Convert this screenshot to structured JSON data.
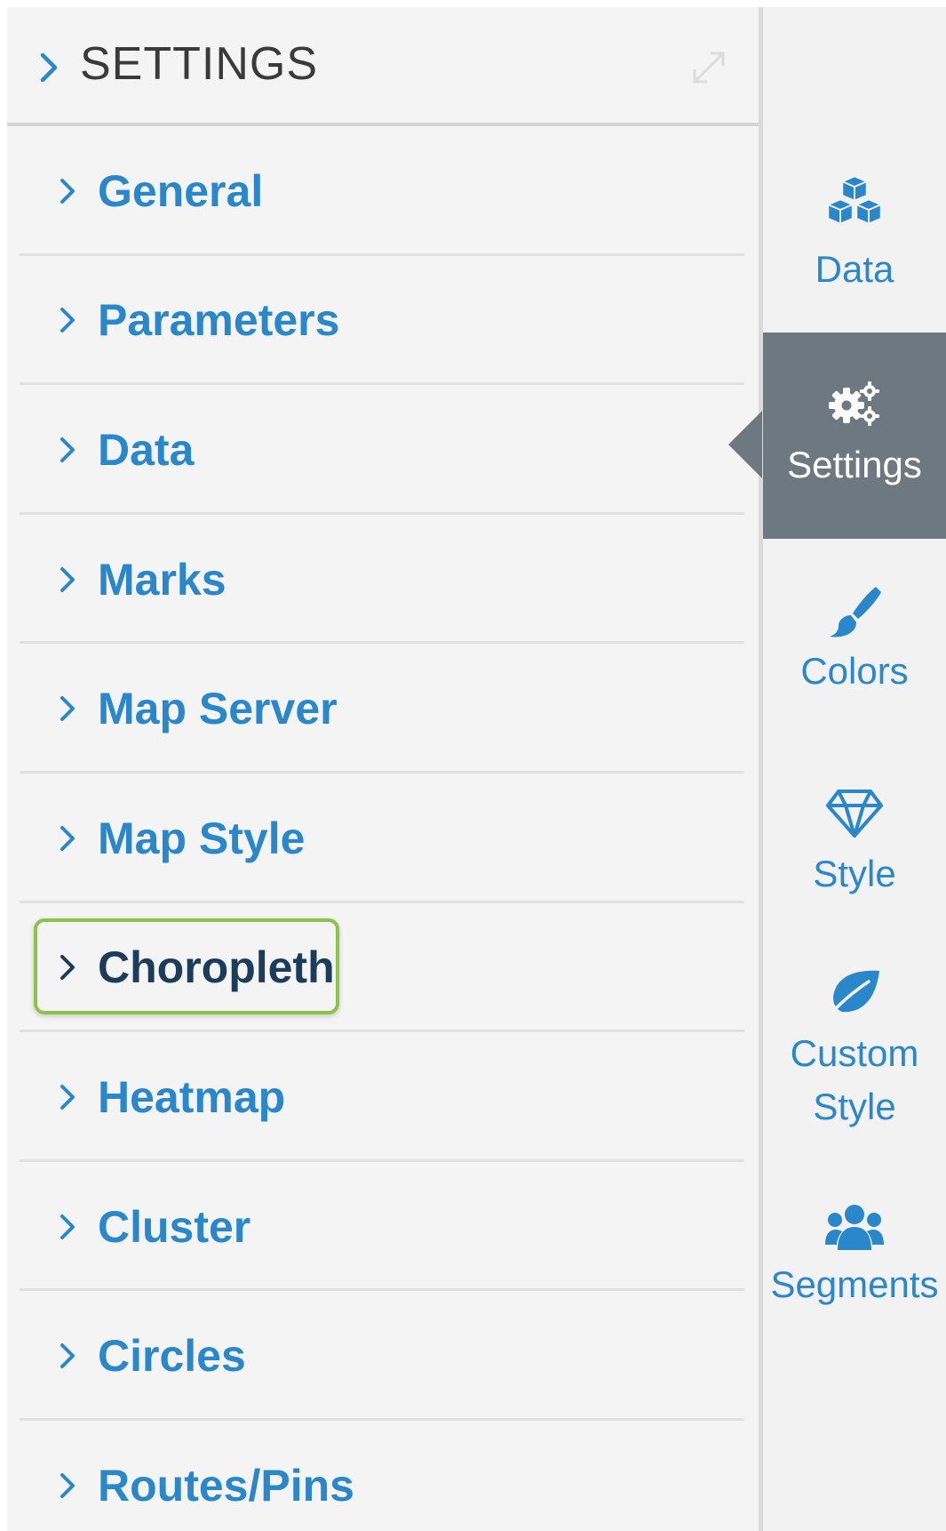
{
  "header": {
    "title": "SETTINGS",
    "chevron_icon": "chevron-right-icon",
    "expand_icon": "expand-arrows-icon"
  },
  "sections": [
    {
      "label": "General"
    },
    {
      "label": "Parameters"
    },
    {
      "label": "Data"
    },
    {
      "label": "Marks"
    },
    {
      "label": "Map Server"
    },
    {
      "label": "Map Style"
    },
    {
      "label": "Choropleth",
      "highlighted": true
    },
    {
      "label": "Heatmap"
    },
    {
      "label": "Cluster"
    },
    {
      "label": "Circles"
    },
    {
      "label": "Routes/Pins"
    }
  ],
  "rail_tabs": [
    {
      "label": "Data",
      "icon": "cubes-icon"
    },
    {
      "label": "Settings",
      "icon": "gears-icon",
      "active": true
    },
    {
      "label": "Colors",
      "icon": "paintbrush-icon"
    },
    {
      "label": "Style",
      "icon": "diamond-icon"
    },
    {
      "label": "Custom Style",
      "line1": "Custom",
      "line2": "Style",
      "icon": "leaf-icon"
    },
    {
      "label": "Segments",
      "icon": "users-icon"
    }
  ],
  "colors": {
    "accent": "#2a87c9",
    "highlight_text": "#1c3c5c",
    "highlight_border": "#8cc34a",
    "active_tab_bg": "#6e7880",
    "panel_bg": "#f4f4f4"
  }
}
